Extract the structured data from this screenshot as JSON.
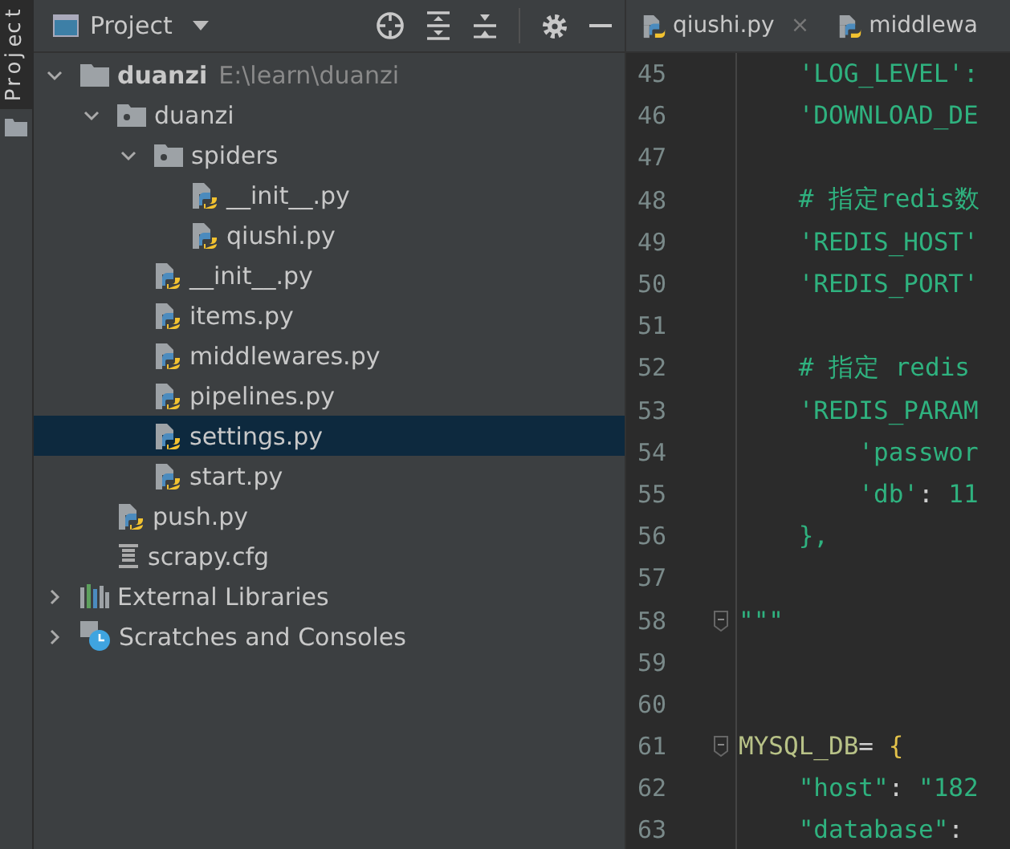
{
  "tool_stripe": {
    "label": "Project"
  },
  "panel": {
    "title": "Project"
  },
  "tree": [
    {
      "name": "duanzi",
      "path": "E:\\learn\\duanzi",
      "kind": "root",
      "expanded": true,
      "selected": false,
      "children": [
        {
          "name": "duanzi",
          "kind": "package",
          "expanded": true,
          "selected": false,
          "children": [
            {
              "name": "spiders",
              "kind": "package",
              "expanded": true,
              "selected": false,
              "children": [
                {
                  "name": "__init__.py",
                  "kind": "python",
                  "selected": false
                },
                {
                  "name": "qiushi.py",
                  "kind": "python",
                  "selected": false
                }
              ]
            },
            {
              "name": "__init__.py",
              "kind": "python",
              "selected": false
            },
            {
              "name": "items.py",
              "kind": "python",
              "selected": false
            },
            {
              "name": "middlewares.py",
              "kind": "python",
              "selected": false
            },
            {
              "name": "pipelines.py",
              "kind": "python",
              "selected": false
            },
            {
              "name": "settings.py",
              "kind": "python",
              "selected": true
            },
            {
              "name": "start.py",
              "kind": "python",
              "selected": false
            }
          ]
        },
        {
          "name": "push.py",
          "kind": "python",
          "selected": false
        },
        {
          "name": "scrapy.cfg",
          "kind": "config",
          "selected": false
        }
      ]
    },
    {
      "name": "External Libraries",
      "kind": "libraries",
      "expanded": false,
      "selected": false
    },
    {
      "name": "Scratches and Consoles",
      "kind": "scratches",
      "expanded": false,
      "selected": false
    }
  ],
  "tabs": [
    {
      "label": "qiushi.py",
      "close": "×"
    },
    {
      "label": "middlewa"
    }
  ],
  "code": [
    {
      "number": "45",
      "tokens": [
        {
          "text": "    'LOG_LEVEL':",
          "kind": "string"
        }
      ]
    },
    {
      "number": "46",
      "tokens": [
        {
          "text": "    'DOWNLOAD_DE",
          "kind": "string"
        }
      ]
    },
    {
      "number": "47"
    },
    {
      "number": "48",
      "tokens": [
        {
          "text": "    # 指定redis数",
          "kind": "comment"
        }
      ]
    },
    {
      "number": "49",
      "tokens": [
        {
          "text": "    'REDIS_HOST'",
          "kind": "string"
        }
      ]
    },
    {
      "number": "50",
      "tokens": [
        {
          "text": "    'REDIS_PORT'",
          "kind": "string"
        }
      ]
    },
    {
      "number": "51"
    },
    {
      "number": "52",
      "tokens": [
        {
          "text": "    # 指定 redis",
          "kind": "comment"
        }
      ]
    },
    {
      "number": "53",
      "tokens": [
        {
          "text": "    'REDIS_PARAM",
          "kind": "string"
        }
      ]
    },
    {
      "number": "54",
      "tokens": [
        {
          "text": "        'passwor",
          "kind": "string"
        }
      ]
    },
    {
      "number": "55",
      "tokens": [
        {
          "text": "        'db'",
          "kind": "string"
        },
        {
          "text": ": ",
          "kind": "punct"
        },
        {
          "text": "11",
          "kind": "string"
        }
      ]
    },
    {
      "number": "56",
      "tokens": [
        {
          "text": "    },",
          "kind": "string"
        }
      ]
    },
    {
      "number": "57"
    },
    {
      "number": "58",
      "fold": true,
      "tokens": [
        {
          "text": "\"\"\"",
          "kind": "string"
        }
      ]
    },
    {
      "number": "59"
    },
    {
      "number": "60"
    },
    {
      "number": "61",
      "fold": true,
      "tokens": [
        {
          "text": "MYSQL_DB",
          "kind": "ident"
        },
        {
          "text": "= ",
          "kind": "punct"
        },
        {
          "text": "{",
          "kind": "brace"
        }
      ]
    },
    {
      "number": "62",
      "tokens": [
        {
          "text": "    \"host\"",
          "kind": "string"
        },
        {
          "text": ": ",
          "kind": "punct"
        },
        {
          "text": "\"182",
          "kind": "string"
        }
      ]
    },
    {
      "number": "63",
      "tokens": [
        {
          "text": "    \"database\"",
          "kind": "string"
        },
        {
          "text": ":",
          "kind": "punct"
        }
      ]
    }
  ]
}
